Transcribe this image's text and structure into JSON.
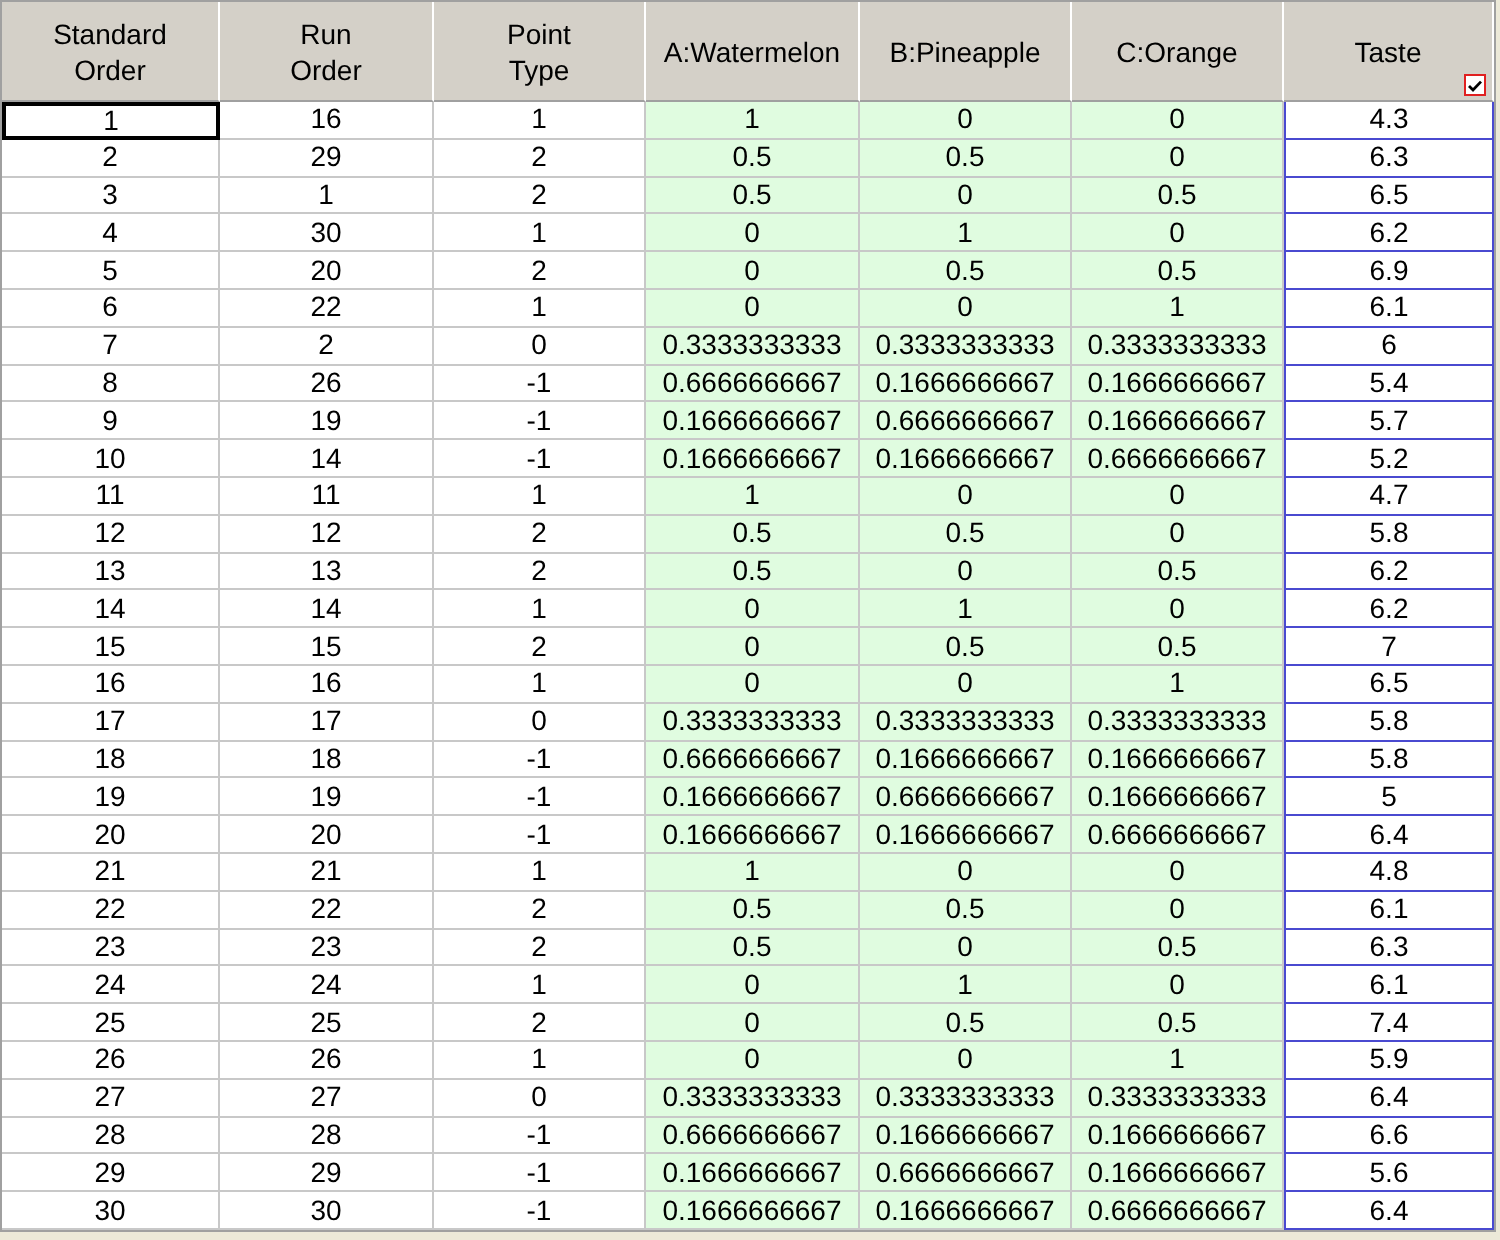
{
  "columns": [
    {
      "label": "Standard Order",
      "kind": "design",
      "checked": false
    },
    {
      "label": "Run Order",
      "kind": "design",
      "checked": false
    },
    {
      "label": "Point Type",
      "kind": "design",
      "checked": false
    },
    {
      "label": "A:Watermelon",
      "kind": "factor",
      "checked": false
    },
    {
      "label": "B:Pineapple",
      "kind": "factor",
      "checked": false
    },
    {
      "label": "C:Orange",
      "kind": "factor",
      "checked": false
    },
    {
      "label": "Taste",
      "kind": "response",
      "checked": true
    }
  ],
  "rows": [
    {
      "selected": true,
      "cells": [
        "1",
        "16",
        "1",
        "1",
        "0",
        "0",
        "4.3"
      ]
    },
    {
      "selected": false,
      "cells": [
        "2",
        "29",
        "2",
        "0.5",
        "0.5",
        "0",
        "6.3"
      ]
    },
    {
      "selected": false,
      "cells": [
        "3",
        "1",
        "2",
        "0.5",
        "0",
        "0.5",
        "6.5"
      ]
    },
    {
      "selected": false,
      "cells": [
        "4",
        "30",
        "1",
        "0",
        "1",
        "0",
        "6.2"
      ]
    },
    {
      "selected": false,
      "cells": [
        "5",
        "20",
        "2",
        "0",
        "0.5",
        "0.5",
        "6.9"
      ]
    },
    {
      "selected": false,
      "cells": [
        "6",
        "22",
        "1",
        "0",
        "0",
        "1",
        "6.1"
      ]
    },
    {
      "selected": false,
      "cells": [
        "7",
        "2",
        "0",
        "0.3333333333",
        "0.3333333333",
        "0.3333333333",
        "6"
      ]
    },
    {
      "selected": false,
      "cells": [
        "8",
        "26",
        "-1",
        "0.6666666667",
        "0.1666666667",
        "0.1666666667",
        "5.4"
      ]
    },
    {
      "selected": false,
      "cells": [
        "9",
        "19",
        "-1",
        "0.1666666667",
        "0.6666666667",
        "0.1666666667",
        "5.7"
      ]
    },
    {
      "selected": false,
      "cells": [
        "10",
        "14",
        "-1",
        "0.1666666667",
        "0.1666666667",
        "0.6666666667",
        "5.2"
      ]
    },
    {
      "selected": false,
      "cells": [
        "11",
        "11",
        "1",
        "1",
        "0",
        "0",
        "4.7"
      ]
    },
    {
      "selected": false,
      "cells": [
        "12",
        "12",
        "2",
        "0.5",
        "0.5",
        "0",
        "5.8"
      ]
    },
    {
      "selected": false,
      "cells": [
        "13",
        "13",
        "2",
        "0.5",
        "0",
        "0.5",
        "6.2"
      ]
    },
    {
      "selected": false,
      "cells": [
        "14",
        "14",
        "1",
        "0",
        "1",
        "0",
        "6.2"
      ]
    },
    {
      "selected": false,
      "cells": [
        "15",
        "15",
        "2",
        "0",
        "0.5",
        "0.5",
        "7"
      ]
    },
    {
      "selected": false,
      "cells": [
        "16",
        "16",
        "1",
        "0",
        "0",
        "1",
        "6.5"
      ]
    },
    {
      "selected": false,
      "cells": [
        "17",
        "17",
        "0",
        "0.3333333333",
        "0.3333333333",
        "0.3333333333",
        "5.8"
      ]
    },
    {
      "selected": false,
      "cells": [
        "18",
        "18",
        "-1",
        "0.6666666667",
        "0.1666666667",
        "0.1666666667",
        "5.8"
      ]
    },
    {
      "selected": false,
      "cells": [
        "19",
        "19",
        "-1",
        "0.1666666667",
        "0.6666666667",
        "0.1666666667",
        "5"
      ]
    },
    {
      "selected": false,
      "cells": [
        "20",
        "20",
        "-1",
        "0.1666666667",
        "0.1666666667",
        "0.6666666667",
        "6.4"
      ]
    },
    {
      "selected": false,
      "cells": [
        "21",
        "21",
        "1",
        "1",
        "0",
        "0",
        "4.8"
      ]
    },
    {
      "selected": false,
      "cells": [
        "22",
        "22",
        "2",
        "0.5",
        "0.5",
        "0",
        "6.1"
      ]
    },
    {
      "selected": false,
      "cells": [
        "23",
        "23",
        "2",
        "0.5",
        "0",
        "0.5",
        "6.3"
      ]
    },
    {
      "selected": false,
      "cells": [
        "24",
        "24",
        "1",
        "0",
        "1",
        "0",
        "6.1"
      ]
    },
    {
      "selected": false,
      "cells": [
        "25",
        "25",
        "2",
        "0",
        "0.5",
        "0.5",
        "7.4"
      ]
    },
    {
      "selected": false,
      "cells": [
        "26",
        "26",
        "1",
        "0",
        "0",
        "1",
        "5.9"
      ]
    },
    {
      "selected": false,
      "cells": [
        "27",
        "27",
        "0",
        "0.3333333333",
        "0.3333333333",
        "0.3333333333",
        "6.4"
      ]
    },
    {
      "selected": false,
      "cells": [
        "28",
        "28",
        "-1",
        "0.6666666667",
        "0.1666666667",
        "0.1666666667",
        "6.6"
      ]
    },
    {
      "selected": false,
      "cells": [
        "29",
        "29",
        "-1",
        "0.1666666667",
        "0.6666666667",
        "0.1666666667",
        "5.6"
      ]
    },
    {
      "selected": false,
      "cells": [
        "30",
        "30",
        "-1",
        "0.1666666667",
        "0.1666666667",
        "0.6666666667",
        "6.4"
      ]
    }
  ]
}
